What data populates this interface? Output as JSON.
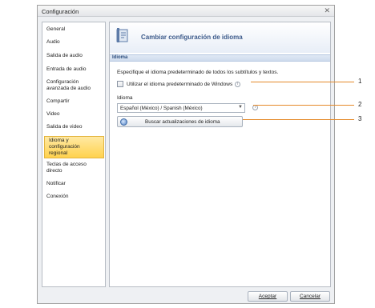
{
  "window": {
    "title": "Configuración",
    "close_glyph": "✕"
  },
  "sidebar": {
    "items": [
      {
        "label": "General"
      },
      {
        "label": "Audio"
      },
      {
        "label": "Salida de audio"
      },
      {
        "label": "Entrada de audio"
      },
      {
        "label": "Configuración avanzada de audio"
      },
      {
        "label": "Compartir"
      },
      {
        "label": "Video"
      },
      {
        "label": "Salida de video"
      },
      {
        "label": "Idioma y configuración regional"
      },
      {
        "label": "Teclas de acceso directo"
      },
      {
        "label": "Notificar"
      },
      {
        "label": "Conexión"
      }
    ],
    "active_index": 8
  },
  "panel": {
    "header_title": "Cambiar configuración de idioma",
    "section_label": "Idioma",
    "description": "Especifique el idioma predeterminado de todos los subtítulos y textos.",
    "checkbox_label": "Utilizar el idioma predeterminado de Windows",
    "checkbox_checked": false,
    "field_label": "Idioma",
    "select_value": "Español (México) / Spanish (México)",
    "update_button": "Buscar actualizaciones de idioma"
  },
  "footer": {
    "accept": "Aceptar",
    "cancel": "Cancelar"
  },
  "callouts": [
    "1",
    "2",
    "3"
  ],
  "colors": {
    "accent": "#3c5a8a",
    "active_item": "#ffd24d",
    "callout_line": "#e58a2a"
  },
  "icons": [
    "language-settings-icon",
    "info-icon",
    "dropdown-arrow-icon",
    "update-globe-icon",
    "close-icon"
  ]
}
